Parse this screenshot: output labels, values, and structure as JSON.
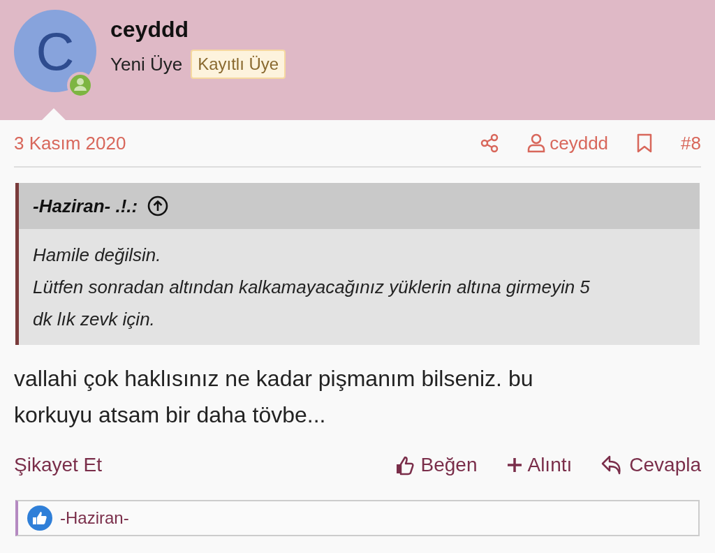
{
  "author": {
    "avatar_letter": "C",
    "name": "ceyddd",
    "title": "Yeni Üye",
    "badge": "Kayıtlı Üye",
    "online": true
  },
  "post": {
    "date": "3 Kasım 2020",
    "author_link": "ceyddd",
    "number": "#8",
    "quote": {
      "author": "-Haziran- .!.:",
      "lines": [
        "Hamile değilsin.",
        "Lütfen sonradan altından kalkamayacağınız yüklerin altına girmeyin 5 dk lık zevk için."
      ]
    },
    "message": "vallahi çok haklısınız ne kadar pişmanım bilseniz. bu korkuyu atsam bir daha tövbe...",
    "report": "Şikayet Et",
    "actions": [
      {
        "kind": "like",
        "label": "Beğen"
      },
      {
        "kind": "quote",
        "label": "Alıntı"
      },
      {
        "kind": "reply",
        "label": "Cevapla"
      }
    ],
    "reactions": {
      "users": "-Haziran-"
    }
  }
}
